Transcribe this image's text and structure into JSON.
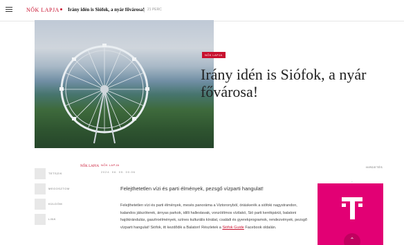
{
  "header": {
    "logo": "NŐK LAPJA",
    "article_title": "Irány idén is Siófok, a nyár fővárosa!",
    "timestamp": "21 PERC"
  },
  "hero": {
    "badge": "NŐK LAPJA",
    "title": "Irány idén is Siófok, a nyár fővárosa!"
  },
  "share": {
    "items": [
      {
        "label": "TETSZIK",
        "icon": "like-icon"
      },
      {
        "label": "MEGOSZTOM",
        "icon": "share-icon"
      },
      {
        "label": "KÜLDÖM",
        "icon": "send-icon"
      },
      {
        "label": "LINK",
        "icon": "link-icon"
      }
    ]
  },
  "meta": {
    "small_logo": "NŐK LAPJA",
    "byline": "NŐK LAPJA",
    "date": "2024. 06. 05. 00:06"
  },
  "article": {
    "lead": "Felejthetetlen vízi és parti élmények, pezsgő vízparti hangulat!",
    "body_before_link": "Felejthetetlen vízi és parti élmények, mesés panoráma a Viztoronyból, óriáskerék a siófoki nagystrandon, kalandos játszóterek, árnyas parkok, idilli hallestavak, vonzóiítmos vízilakó, Sió parti kerékpárút, balatoni hajókirándulás, gasztroélmények, színes kulturális kínálat, családi és gyerekprogramok, rendezvények, pezsgő vízparti hangulat! Siófok, itt kezdődik a Balaton! Részletek a ",
    "link_text": "Siófok Guide",
    "body_after_link": " Facebook oldalán."
  },
  "ad": {
    "label": "HIRDETÉS",
    "tiny": "T",
    "up_arrow": "⌃",
    "brand_color": "#e20074"
  },
  "colors": {
    "accent": "#c8102e"
  }
}
